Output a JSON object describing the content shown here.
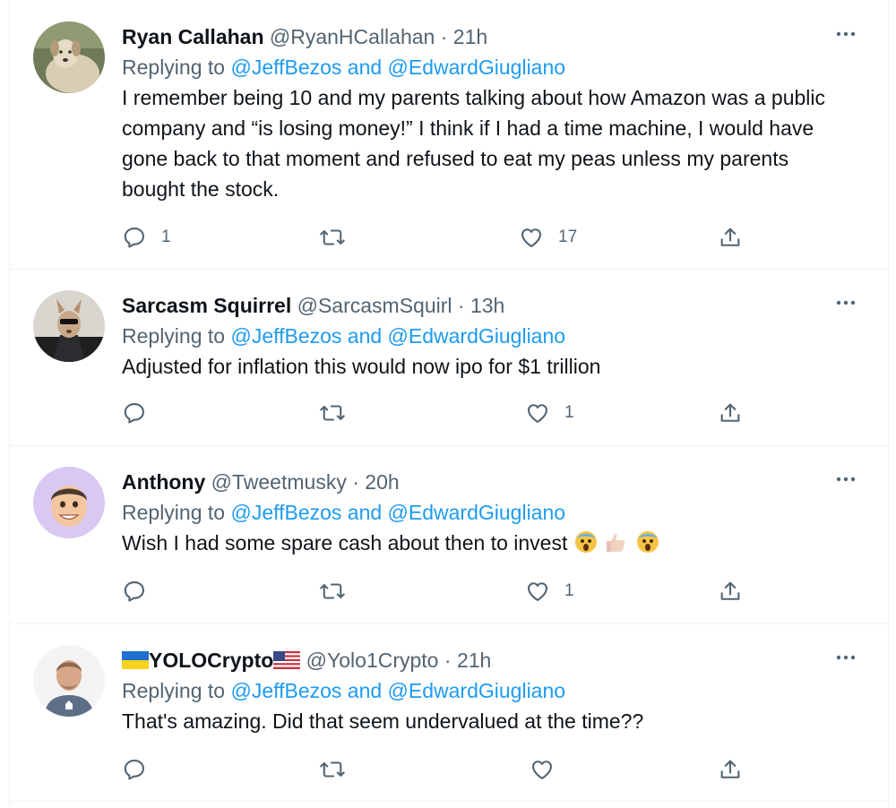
{
  "replying_prefix": "Replying to",
  "tweets": [
    {
      "display_name": "Ryan Callahan",
      "handle": "@RyanHCallahan",
      "time": "21h",
      "mentions": "@JeffBezos and @EdwardGiugliano",
      "text": "I remember being 10 and my parents talking about how Amazon was a public company and “is losing money!” I think if I had a time machine, I would have gone back to that moment and refused to eat my peas unless my parents bought the stock.",
      "reply_count": "1",
      "retweet_count": "",
      "like_count": "17",
      "avatar_icon": "dog-avatar"
    },
    {
      "display_name": "Sarcasm Squirrel",
      "handle": "@SarcasmSquirl",
      "time": "13h",
      "mentions": "@JeffBezos and @EdwardGiugliano",
      "text": "Adjusted for inflation this would now ipo for $1 trillion",
      "reply_count": "",
      "retweet_count": "",
      "like_count": "1",
      "avatar_icon": "squirrel-avatar"
    },
    {
      "display_name": "Anthony",
      "handle": "@Tweetmusky",
      "time": "20h",
      "mentions": "@JeffBezos and @EdwardGiugliano",
      "text": "Wish I had some spare cash about then to invest",
      "text_emoji": [
        "scream-emoji",
        "thumbs-up-emoji",
        "scream-emoji"
      ],
      "reply_count": "",
      "retweet_count": "",
      "like_count": "1",
      "avatar_icon": "memoji-avatar"
    },
    {
      "display_name": "YOLOCrypto",
      "name_prefix_icon": "ukraine-flag-icon",
      "name_suffix_icon": "us-flag-icon",
      "handle": "@Yolo1Crypto",
      "time": "21h",
      "mentions": "@JeffBezos and @EdwardGiugliano",
      "text": "That's amazing. Did that seem undervalued at the time??",
      "reply_count": "",
      "retweet_count": "",
      "like_count": "",
      "avatar_icon": "person-avatar"
    }
  ],
  "colors": {
    "link": "#1d9bf0",
    "secondary_text": "#536471",
    "primary_text": "#0f1419",
    "divider": "#eff3f4"
  }
}
